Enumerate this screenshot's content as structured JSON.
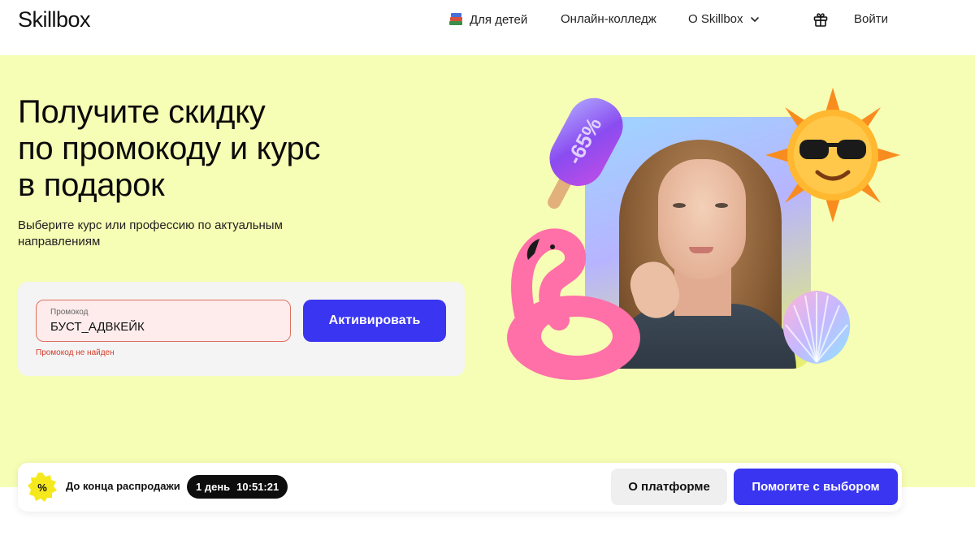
{
  "header": {
    "logo": "Skillbox",
    "nav": {
      "kids": "Для детей",
      "college": "Онлайн-колледж",
      "about": "О Skillbox",
      "login": "Войти"
    },
    "icons": {
      "kids": "books-icon",
      "about_dropdown": "chevron-down-icon",
      "gift": "gift-icon"
    }
  },
  "hero": {
    "title_lines": [
      "Получите скидку",
      "по промокоду и курс",
      "в подарок"
    ],
    "subtitle_lines": [
      "Выберите курс или профессию по актуальным",
      "направлениям"
    ],
    "popsicle_text": "-65%",
    "promo": {
      "label": "Промокод",
      "value": "БУСТ_АДВКЕЙК",
      "error": "Промокод не найден",
      "button": "Активировать"
    }
  },
  "bottom_bar": {
    "badge_icon": "percent-icon",
    "sale_label": "До конца распродажи",
    "timer": {
      "days": "1 день",
      "time": "10:51:21"
    },
    "about_button": "О платформе",
    "help_button": "Помогите с выбором"
  },
  "colors": {
    "accent": "#3a35f0",
    "hero_bg": "#f6fdb4",
    "error": "#d33c2b"
  }
}
